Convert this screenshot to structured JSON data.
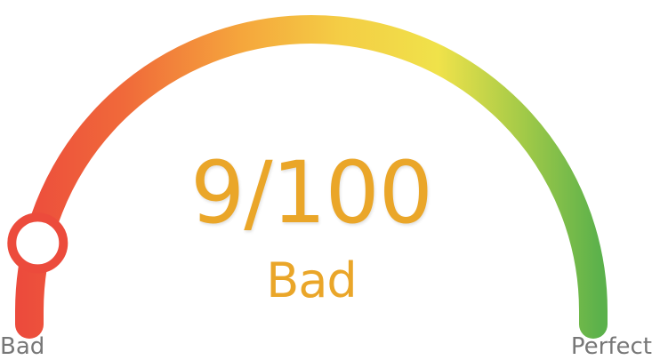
{
  "gauge": {
    "score_text": "9/100",
    "rating_text": "Bad",
    "score": 9,
    "max": 100,
    "min_label": "Bad",
    "max_label": "Perfect",
    "colors": {
      "red": "#EC4B3C",
      "orange": "#F3923A",
      "yellow": "#F4E54A",
      "green": "#5BB14B",
      "score_text": "#EAA629",
      "end_label": "#777777"
    }
  }
}
